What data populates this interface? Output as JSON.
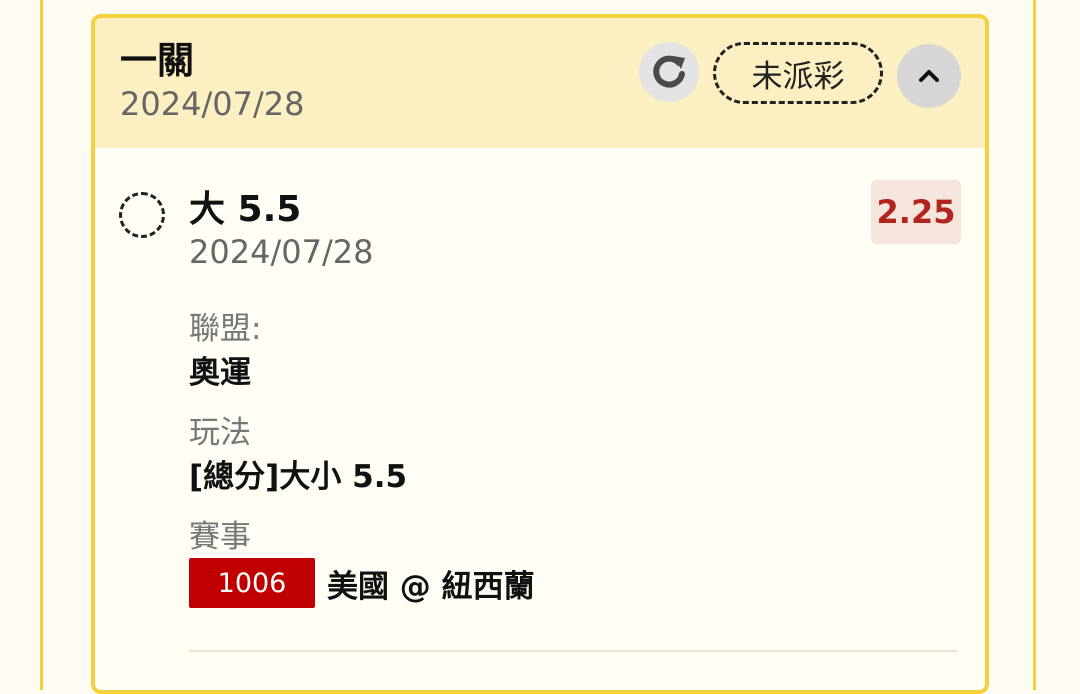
{
  "header": {
    "bet_type": "一關",
    "date": "2024/07/28",
    "status": "未派彩"
  },
  "selection": {
    "name": "大 5.5",
    "date": "2024/07/28",
    "odds": "2.25"
  },
  "details": {
    "league_label": "聯盟:",
    "league_value": "奧運",
    "play_label": "玩法",
    "play_value": "[總分]大小 5.5",
    "event_label": "賽事",
    "event_id": "1006",
    "event_name": "美國 @ 紐西蘭"
  },
  "icons": {
    "refresh": "refresh-icon",
    "collapse": "chevron-up-icon"
  },
  "colors": {
    "accent_yellow": "#f5d23d",
    "header_bg": "#fcefc2",
    "odds_red": "#b3241c",
    "event_badge_red": "#c00000"
  }
}
